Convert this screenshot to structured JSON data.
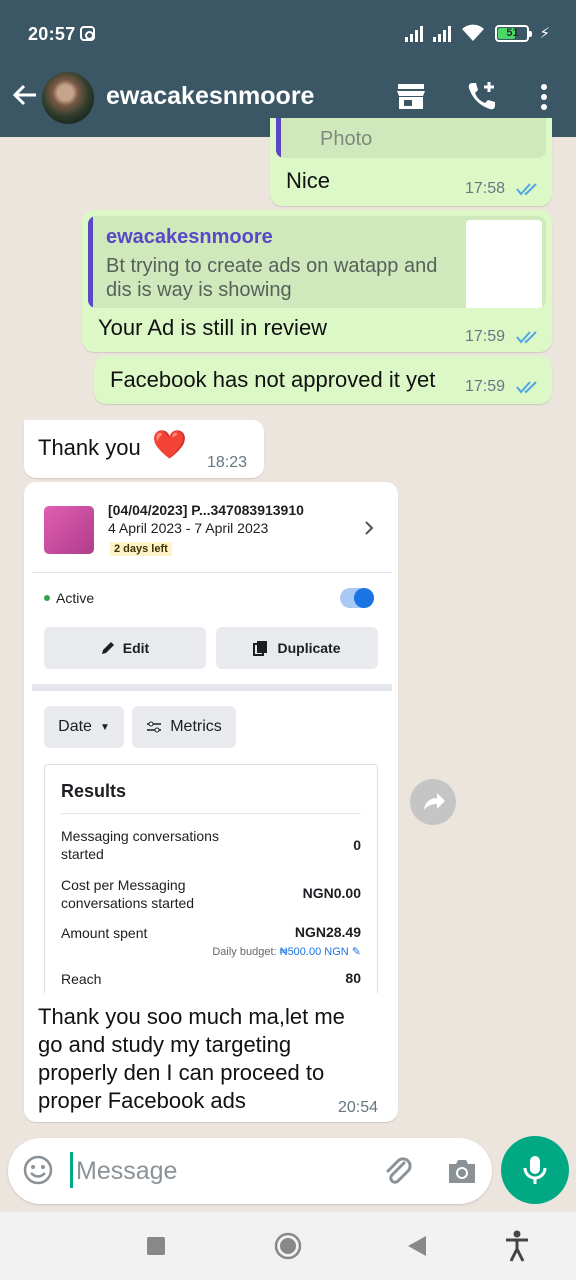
{
  "status_bar": {
    "time": "20:57",
    "battery": "51",
    "colors": {
      "bar_bg": "#3b5765",
      "battery_fill": "#4ad964"
    }
  },
  "header": {
    "contact_name": "ewacakesnmoore",
    "icons": [
      "back-arrow-icon",
      "store-icon",
      "add-call-icon",
      "more-vert-icon"
    ]
  },
  "messages": {
    "m0": {
      "partial_label": "Photo",
      "text": "Nice",
      "time": "17:58"
    },
    "m1": {
      "quote_author": "ewacakesnmoore",
      "quote_text": "Bt trying to create ads on watapp and dis is way is showing",
      "text": "Your Ad is still in review",
      "time": "17:59"
    },
    "m2": {
      "text": "Facebook has not approved it yet",
      "time": "17:59"
    },
    "m3": {
      "text": "Thank you",
      "emoji": "❤️",
      "time": "18:23"
    },
    "m4": {
      "ad": {
        "title": "[04/04/2023] P...347083913910",
        "dates": "4 April 2023 - 7 April 2023",
        "days_left": "2 days left",
        "status": "Active",
        "edit_label": "Edit",
        "duplicate_label": "Duplicate",
        "date_label": "Date",
        "metrics_label": "Metrics",
        "results_title": "Results",
        "rows": [
          {
            "label": "Messaging conversations started",
            "value": "0"
          },
          {
            "label": "Cost per Messaging conversations started",
            "value": "NGN0.00"
          },
          {
            "label": "Amount spent",
            "value": "NGN28.49"
          },
          {
            "label": "Reach",
            "value": "80"
          }
        ],
        "budget_label": "Daily budget:",
        "budget_value": "₦500.00 NGN"
      },
      "text": "Thank you soo much ma,let me go and study my targeting properly den I can proceed to proper Facebook ads",
      "time": "20:54"
    }
  },
  "input": {
    "placeholder": "Message"
  },
  "colors": {
    "outgoing": "#dcf8c6",
    "incoming": "#ffffff",
    "accent": "#00a884",
    "tick_blue": "#4fa6e8"
  }
}
